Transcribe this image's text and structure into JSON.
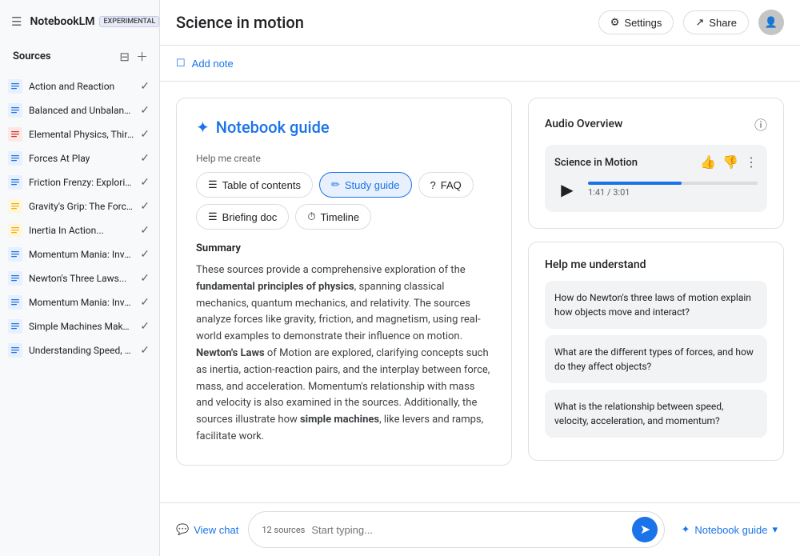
{
  "app": {
    "name": "NotebookLM",
    "badge": "EXPERIMENTAL"
  },
  "topbar": {
    "title": "Science in motion",
    "settings_label": "Settings",
    "share_label": "Share"
  },
  "add_note": {
    "label": "Add note"
  },
  "sidebar": {
    "title": "Sources",
    "sources": [
      {
        "id": 1,
        "label": "Action and Reaction",
        "icon_type": "blue",
        "icon": "≡"
      },
      {
        "id": 2,
        "label": "Balanced and Unbalance...",
        "icon_type": "blue",
        "icon": "≡"
      },
      {
        "id": 3,
        "label": "Elemental Physics, Third...",
        "icon_type": "red",
        "icon": "☰"
      },
      {
        "id": 4,
        "label": "Forces At Play",
        "icon_type": "blue",
        "icon": "≡"
      },
      {
        "id": 5,
        "label": "Friction Frenzy: Explorin...",
        "icon_type": "blue",
        "icon": "≡"
      },
      {
        "id": 6,
        "label": "Gravity's Grip: The Force...",
        "icon_type": "yellow",
        "icon": "☰"
      },
      {
        "id": 7,
        "label": "Inertia In Action...",
        "icon_type": "yellow",
        "icon": "☰"
      },
      {
        "id": 8,
        "label": "Momentum Mania: Inves...",
        "icon_type": "blue",
        "icon": "≡"
      },
      {
        "id": 9,
        "label": "Newton's Three Laws...",
        "icon_type": "blue",
        "icon": "≡"
      },
      {
        "id": 10,
        "label": "Momentum Mania: Inves...",
        "icon_type": "blue",
        "icon": "≡"
      },
      {
        "id": 11,
        "label": "Simple Machines Make...",
        "icon_type": "blue",
        "icon": "≡"
      },
      {
        "id": 12,
        "label": "Understanding Speed, Ve...",
        "icon_type": "blue",
        "icon": "≡"
      }
    ]
  },
  "guide": {
    "title": "Notebook guide",
    "help_create_label": "Help me create",
    "buttons": [
      {
        "id": "toc",
        "label": "Table of contents",
        "icon": "☰"
      },
      {
        "id": "study",
        "label": "Study guide",
        "icon": "✏"
      },
      {
        "id": "faq",
        "label": "FAQ",
        "icon": "?"
      },
      {
        "id": "briefing",
        "label": "Briefing doc",
        "icon": "☰"
      },
      {
        "id": "timeline",
        "label": "Timeline",
        "icon": "⏱"
      }
    ],
    "summary_title": "Summary",
    "summary_text": "These sources provide a comprehensive exploration of the fundamental principles of physics, spanning classical mechanics, quantum mechanics, and relativity. The sources analyze forces like gravity, friction, and magnetism, using real-world examples to demonstrate their influence on motion. Newton's Laws of Motion are explored, clarifying concepts such as inertia, action-reaction pairs, and the interplay between force, mass, and acceleration. Momentum's relationship with mass and velocity is also examined in the sources. Additionally, the sources illustrate how simple machines, like levers and ramps, facilitate work."
  },
  "audio": {
    "section_title": "Audio Overview",
    "track_title": "Science in Motion",
    "time_elapsed": "1:41",
    "time_total": "3:01",
    "progress_percent": 55
  },
  "understand": {
    "title": "Help me understand",
    "questions": [
      "How do Newton's three laws of motion explain how objects move and interact?",
      "What are the different types of forces, and how do they affect objects?",
      "What is the relationship between speed, velocity, acceleration, and momentum?"
    ]
  },
  "bottom": {
    "view_chat_label": "View chat",
    "sources_count": "12 sources",
    "input_placeholder": "Start typing...",
    "notebook_guide_label": "Notebook guide"
  }
}
